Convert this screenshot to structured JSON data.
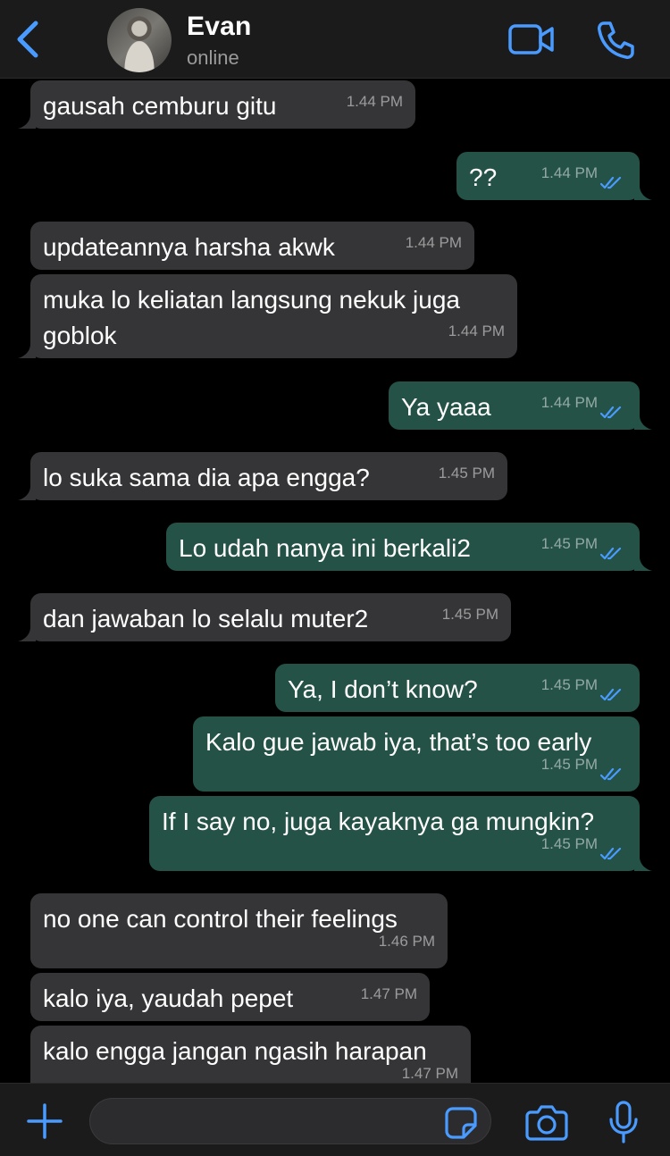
{
  "colors": {
    "accent": "#4a9bff",
    "incoming_bubble": "#353537",
    "outgoing_bubble": "#245247",
    "background": "#000000",
    "bar": "#1b1b1b"
  },
  "header": {
    "contact_name": "Evan",
    "status": "online",
    "icons": [
      "back-chevron-icon",
      "video-call-icon",
      "voice-call-icon"
    ]
  },
  "messages": [
    {
      "dir": "in",
      "text": "gausah cemburu gitu",
      "time": "1.44 PM"
    },
    {
      "dir": "out",
      "text": "??",
      "time": "1.44 PM",
      "read": true
    },
    {
      "dir": "in",
      "text": "updateannya harsha akwk",
      "time": "1.44 PM"
    },
    {
      "dir": "in",
      "text": "muka lo keliatan langsung nekuk juga",
      "text2": "goblok",
      "time": "1.44 PM"
    },
    {
      "dir": "out",
      "text": "Ya yaaa",
      "time": "1.44 PM",
      "read": true
    },
    {
      "dir": "in",
      "text": "lo suka sama dia apa engga?",
      "time": "1.45 PM"
    },
    {
      "dir": "out",
      "text": "Lo udah nanya ini berkali2",
      "time": "1.45 PM",
      "read": true
    },
    {
      "dir": "in",
      "text": "dan jawaban lo selalu muter2",
      "time": "1.45 PM"
    },
    {
      "dir": "out",
      "text": "Ya, I don’t know?",
      "time": "1.45 PM",
      "read": true
    },
    {
      "dir": "out",
      "text": "Kalo gue jawab iya, that’s too early",
      "time": "1.45 PM",
      "read": true
    },
    {
      "dir": "out",
      "text": "If I say no, juga kayaknya ga mungkin?",
      "time": "1.45 PM",
      "read": true
    },
    {
      "dir": "in",
      "text": "no one can control their feelings",
      "time": "1.46 PM"
    },
    {
      "dir": "in",
      "text": "kalo iya, yaudah pepet",
      "time": "1.47 PM"
    },
    {
      "dir": "in",
      "text": "kalo engga jangan ngasih harapan",
      "time": "1.47 PM"
    }
  ],
  "composer": {
    "value": "",
    "icons": [
      "plus-icon",
      "sticker-icon",
      "camera-icon",
      "microphone-icon"
    ]
  }
}
